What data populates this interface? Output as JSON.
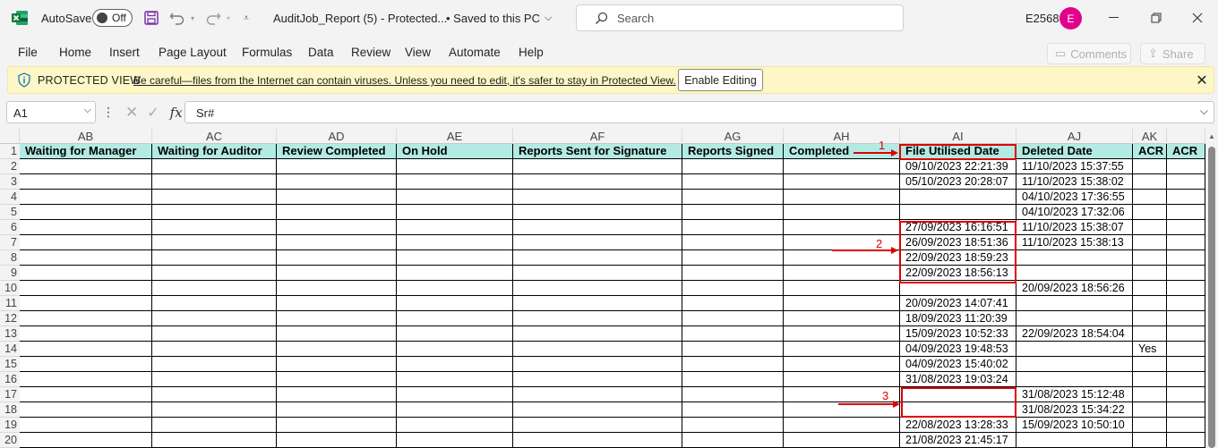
{
  "titlebar": {
    "autosave_label": "AutoSave",
    "autosave_state": "Off",
    "doc_title": "AuditJob_Report (5)  -  Protected...",
    "saved_status": "•  Saved to this PC",
    "search_placeholder": "Search",
    "user_code": "E2568",
    "avatar_initial": "E"
  },
  "ribbon": {
    "tabs": [
      "File",
      "Home",
      "Insert",
      "Page Layout",
      "Formulas",
      "Data",
      "Review",
      "View",
      "Automate",
      "Help"
    ],
    "comments_label": "Comments",
    "share_label": "Share"
  },
  "protected_view": {
    "title": "PROTECTED VIEW",
    "message": "Be careful—files from the Internet can contain viruses. Unless you need to edit, it's safer to stay in Protected View.",
    "enable_label": "Enable Editing"
  },
  "formula_bar": {
    "name_box": "A1",
    "fx_label": "fx",
    "formula": "Sr#"
  },
  "grid": {
    "columns": [
      "AB",
      "AC",
      "AD",
      "AE",
      "AF",
      "AG",
      "AH",
      "AI",
      "AJ",
      "AK",
      ""
    ],
    "row_numbers": [
      "1",
      "2",
      "3",
      "4",
      "5",
      "6",
      "7",
      "8",
      "9",
      "10",
      "11",
      "12",
      "13",
      "14",
      "15",
      "16",
      "17",
      "18",
      "19",
      "20"
    ],
    "header_row": [
      "Waiting for Manager",
      "Waiting for Auditor",
      "Review Completed",
      "On Hold",
      "Reports Sent for Signature",
      "Reports Signed",
      "Completed",
      "File Utilised Date",
      "Deleted Date",
      "ACR",
      "ACR"
    ],
    "rows": [
      [
        "",
        "",
        "",
        "",
        "",
        "",
        "",
        "09/10/2023 22:21:39",
        "11/10/2023 15:37:55",
        "",
        ""
      ],
      [
        "",
        "",
        "",
        "",
        "",
        "",
        "",
        "05/10/2023 20:28:07",
        "11/10/2023 15:38:02",
        "",
        ""
      ],
      [
        "",
        "",
        "",
        "",
        "",
        "",
        "",
        "",
        "04/10/2023 17:36:55",
        "",
        ""
      ],
      [
        "",
        "",
        "",
        "",
        "",
        "",
        "",
        "",
        "04/10/2023 17:32:06",
        "",
        ""
      ],
      [
        "",
        "",
        "",
        "",
        "",
        "",
        "",
        "27/09/2023 16:16:51",
        "11/10/2023 15:38:07",
        "",
        ""
      ],
      [
        "",
        "",
        "",
        "",
        "",
        "",
        "",
        "26/09/2023 18:51:36",
        "11/10/2023 15:38:13",
        "",
        ""
      ],
      [
        "",
        "",
        "",
        "",
        "",
        "",
        "",
        "22/09/2023 18:59:23",
        "",
        "",
        ""
      ],
      [
        "",
        "",
        "",
        "",
        "",
        "",
        "",
        "22/09/2023 18:56:13",
        "",
        "",
        ""
      ],
      [
        "",
        "",
        "",
        "",
        "",
        "",
        "",
        "",
        "20/09/2023 18:56:26",
        "",
        ""
      ],
      [
        "",
        "",
        "",
        "",
        "",
        "",
        "",
        "20/09/2023 14:07:41",
        "",
        "",
        ""
      ],
      [
        "",
        "",
        "",
        "",
        "",
        "",
        "",
        "18/09/2023 11:20:39",
        "",
        "",
        ""
      ],
      [
        "",
        "",
        "",
        "",
        "",
        "",
        "",
        "15/09/2023 10:52:33",
        "22/09/2023 18:54:04",
        "",
        ""
      ],
      [
        "",
        "",
        "",
        "",
        "",
        "",
        "",
        "04/09/2023 19:48:53",
        "",
        "Yes",
        ""
      ],
      [
        "",
        "",
        "",
        "",
        "",
        "",
        "",
        "04/09/2023 15:40:02",
        "",
        "",
        ""
      ],
      [
        "",
        "",
        "",
        "",
        "",
        "",
        "",
        "31/08/2023 19:03:24",
        "",
        "",
        ""
      ],
      [
        "",
        "",
        "",
        "",
        "",
        "",
        "",
        "",
        "31/08/2023 15:12:48",
        "",
        ""
      ],
      [
        "",
        "",
        "",
        "",
        "",
        "",
        "",
        "",
        "31/08/2023 15:34:22",
        "",
        ""
      ],
      [
        "",
        "",
        "",
        "",
        "",
        "",
        "",
        "22/08/2023 13:28:33",
        "15/09/2023 10:50:10",
        "",
        ""
      ],
      [
        "",
        "",
        "",
        "",
        "",
        "",
        "",
        "21/08/2023 21:45:17",
        "",
        "",
        ""
      ]
    ]
  },
  "annotations": {
    "labels": [
      "1",
      "2",
      "3"
    ],
    "color": "#e00000"
  },
  "colors": {
    "header_fill": "#b3ebe4",
    "avatar": "#e3008c",
    "excel_green": "#107c41",
    "save_purple": "#7b2fa8",
    "protected_bar": "#fdf6c6"
  }
}
